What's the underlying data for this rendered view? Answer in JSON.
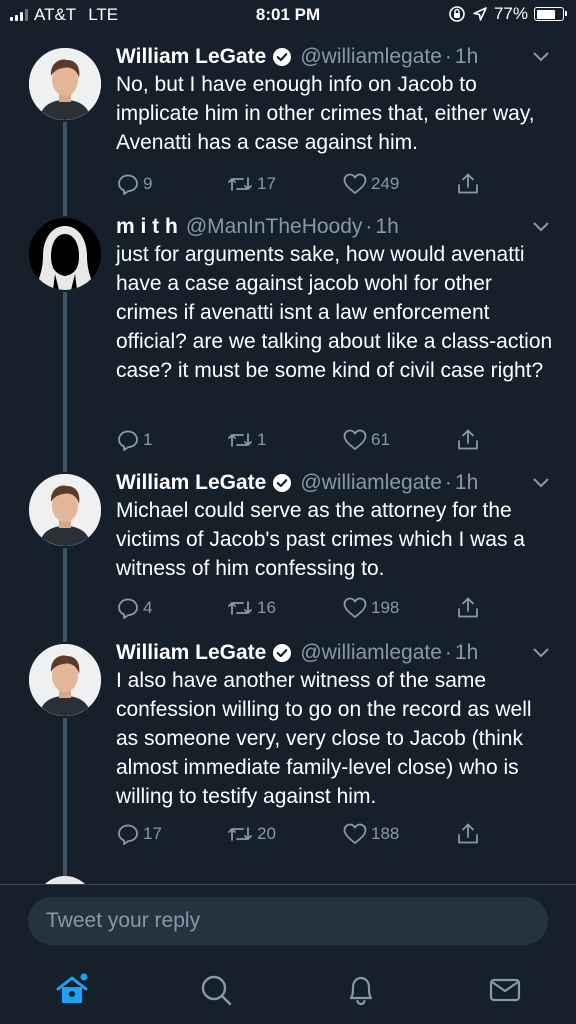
{
  "status_bar": {
    "carrier": "AT&T",
    "network": "LTE",
    "time": "8:01 PM",
    "battery_percent": "77%",
    "battery_level": 0.77
  },
  "tweets": [
    {
      "name": "William LeGate",
      "verified": true,
      "handle": "@williamlegate",
      "separator": "·",
      "time": "1h",
      "text": "No, but I have enough info on Jacob to implicate him in other crimes that, either way, Avenatti has a case against him.",
      "replies": "9",
      "retweets": "17",
      "likes": "249"
    },
    {
      "name": "m i t h",
      "verified": false,
      "handle": "@ManInTheHoody",
      "separator": "·",
      "time": "1h",
      "text": "just for arguments sake, how would avenatti have a case against jacob wohl for other crimes if avenatti isnt a law enforcement official? are we talking about like a class-action case? it must be some kind of civil case right?",
      "replies": "1",
      "retweets": "1",
      "likes": "61"
    },
    {
      "name": "William LeGate",
      "verified": true,
      "handle": "@williamlegate",
      "separator": "·",
      "time": "1h",
      "text": "Michael could serve as the attorney for the victims of Jacob's past crimes which I was a witness of him confessing to.",
      "replies": "4",
      "retweets": "16",
      "likes": "198"
    },
    {
      "name": "William LeGate",
      "verified": true,
      "handle": "@williamlegate",
      "separator": "·",
      "time": "1h",
      "text": "I also have another witness of the same confession willing to go on the record as well as someone very, very close to Jacob (think almost immediate family-level close) who is willing to testify against him.",
      "replies": "17",
      "retweets": "20",
      "likes": "188"
    }
  ],
  "reply": {
    "placeholder": "Tweet your reply"
  },
  "tabbar": {
    "items": [
      "home-icon",
      "search-icon",
      "notifications-icon",
      "messages-icon"
    ],
    "active": "home-icon",
    "active_color": "#1da1f2"
  },
  "colors": {
    "background": "#15202b",
    "secondary_text": "#8899a6",
    "accent": "#1da1f2"
  }
}
